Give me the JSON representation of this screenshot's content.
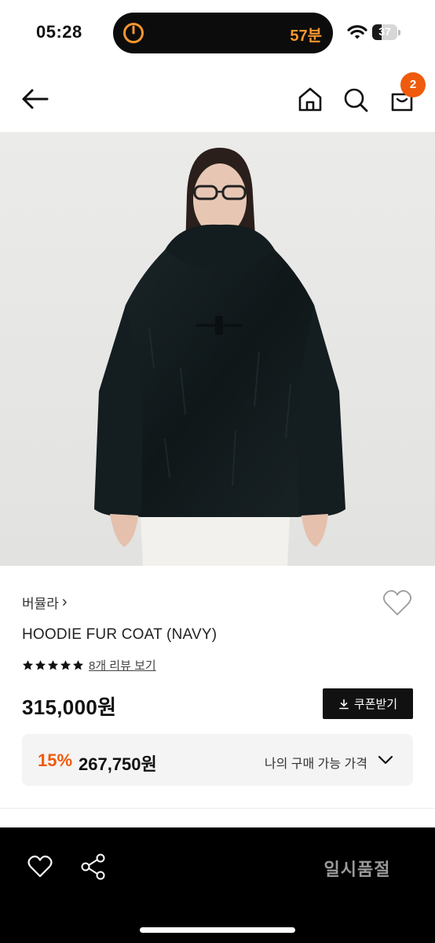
{
  "status_bar": {
    "time": "05:28",
    "activity_text": "57분",
    "battery_percent": "37",
    "battery_level": 0.37,
    "activity_color": "#f7962f"
  },
  "nav": {
    "back_icon": "arrow-left-icon",
    "home_icon": "home-icon",
    "search_icon": "search-icon",
    "cart_icon": "shopping-bag-icon",
    "cart_count": "2",
    "badge_color": "#f05a0c"
  },
  "product": {
    "brand": "버뮬라",
    "brand_chevron": "›",
    "name": "HOODIE FUR COAT (NAVY)",
    "rating_stars": 5,
    "review_link": "8개 리뷰 보기",
    "price": "315,000원",
    "coupon_label": "쿠폰받기",
    "coupon_icon": "download-icon",
    "wishlist_icon": "heart-outline-icon"
  },
  "discount": {
    "rate": "15%",
    "price": "267,750원",
    "label": "나의 구매 가능 가격",
    "chevron_icon": "chevron-down-icon",
    "accent_color": "#f05a0c"
  },
  "bottom_bar": {
    "like_icon": "heart-icon",
    "share_icon": "share-icon",
    "status_label": "일시품절"
  }
}
